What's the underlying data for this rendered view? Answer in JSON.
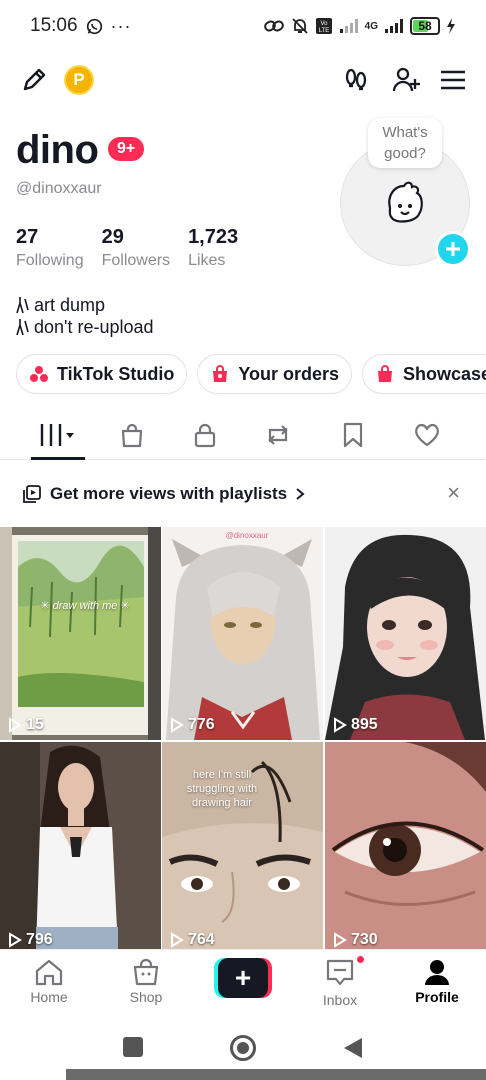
{
  "status_bar": {
    "time": "15:06",
    "network": "4G",
    "volte": "Vo LTE",
    "battery": "58",
    "battery_level": 0.58
  },
  "profile": {
    "username": "dino",
    "notification_badge": "9+",
    "handle": "@dinoxxaur",
    "stats": [
      {
        "number": "27",
        "label": "Following"
      },
      {
        "number": "29",
        "label": "Followers"
      },
      {
        "number": "1,723",
        "label": "Likes"
      }
    ],
    "avatar_bubble": [
      "What's",
      "good?"
    ],
    "bio": [
      "art dump",
      "don't re-upload"
    ]
  },
  "pills": [
    {
      "label": "TikTok Studio",
      "icon": "studio-icon"
    },
    {
      "label": "Your orders",
      "icon": "orders-icon"
    },
    {
      "label": "Showcase",
      "icon": "showcase-icon"
    }
  ],
  "tabs": [
    "videos-grid-icon",
    "shop-bag-icon",
    "lock-icon",
    "repost-icon",
    "bookmark-icon",
    "heart-icon"
  ],
  "playlist_banner": {
    "text": "Get more views with playlists",
    "close": "×"
  },
  "videos": [
    {
      "views": "15",
      "overlay": "✳ draw with me ✳"
    },
    {
      "views": "776",
      "overlay": "@dinoxxaur"
    },
    {
      "views": "895",
      "overlay": ""
    },
    {
      "views": "796",
      "overlay": ""
    },
    {
      "views": "764",
      "overlay": "here I'm still struggling with drawing hair"
    },
    {
      "views": "730",
      "overlay": ""
    }
  ],
  "bottom_nav": [
    {
      "label": "Home",
      "icon": "home-icon"
    },
    {
      "label": "Shop",
      "icon": "shop-icon"
    },
    {
      "label": "+",
      "icon": "create-icon"
    },
    {
      "label": "Inbox",
      "icon": "inbox-icon"
    },
    {
      "label": "Profile",
      "icon": "profile-icon"
    }
  ],
  "colors": {
    "accent": "#fe2c55",
    "cyan": "#25f4ee",
    "text_secondary": "#8a8b91"
  }
}
